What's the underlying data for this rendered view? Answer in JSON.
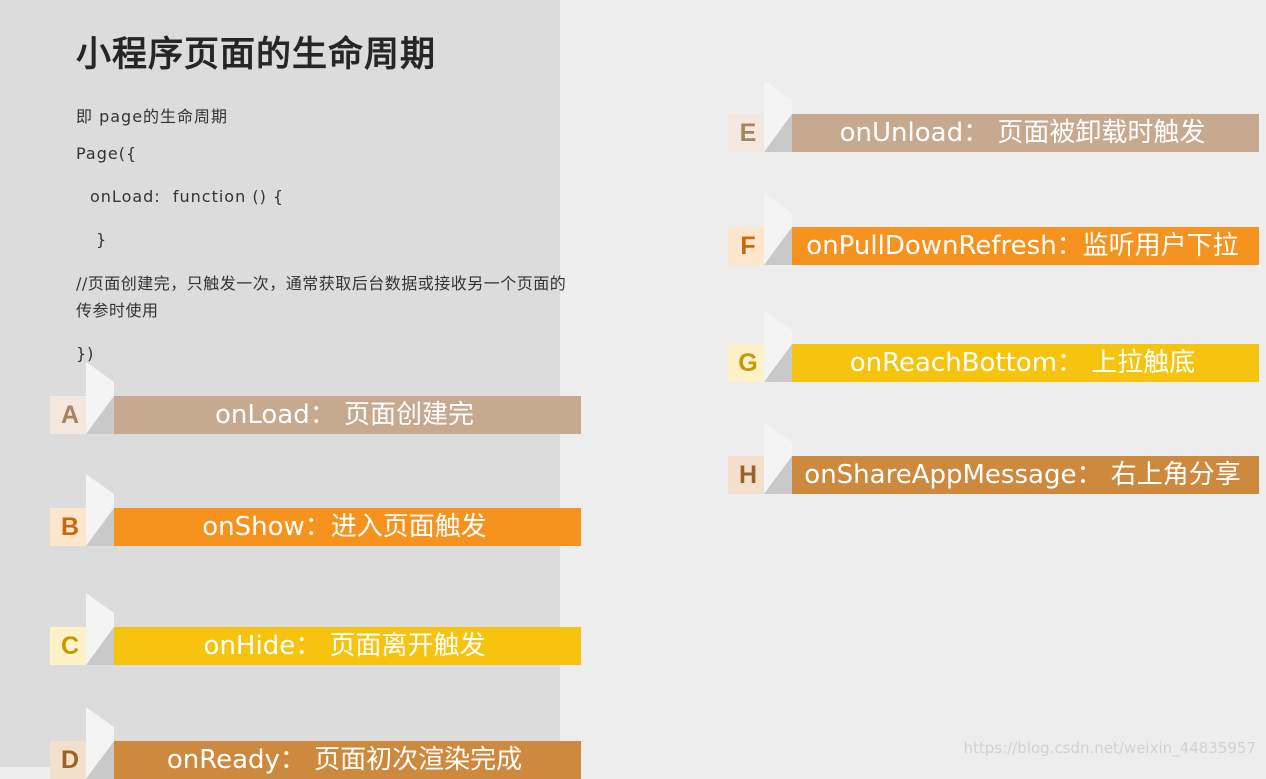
{
  "title": "小程序页面的生命周期",
  "code": {
    "line1": "即 page的生命周期",
    "line2": "Page({",
    "line3": "onLoad:  function () {",
    "line4": "}",
    "comment": "//页面创建完，只触发一次，通常获取后台数据或接收另一个页面的传参时使用",
    "line5": "})"
  },
  "lifecycle": {
    "a": {
      "letter": "A",
      "label": "onLoad：  页面创建完",
      "color": "#c6a98e",
      "letter_bg": "#f2e8df",
      "letter_color": "#a7845f"
    },
    "b": {
      "letter": "B",
      "label": "onShow：进入页面触发",
      "color": "#f6921e",
      "letter_bg": "#fde6cc",
      "letter_color": "#c66a0c"
    },
    "c": {
      "letter": "C",
      "label": "onHide：  页面离开触发",
      "color": "#f6c40e",
      "letter_bg": "#fdf1c8",
      "letter_color": "#c49a05"
    },
    "d": {
      "letter": "D",
      "label": "onReady：  页面初次渲染完成",
      "color": "#cd8a3e",
      "letter_bg": "#f2e0cc",
      "letter_color": "#9a6326"
    },
    "e": {
      "letter": "E",
      "label": "onUnload：  页面被卸载时触发",
      "color": "#c6a98e",
      "letter_bg": "#f2e8df",
      "letter_color": "#a7845f"
    },
    "f": {
      "letter": "F",
      "label": "onPullDownRefresh：监听用户下拉",
      "color": "#f6921e",
      "letter_bg": "#fde6cc",
      "letter_color": "#c66a0c"
    },
    "g": {
      "letter": "G",
      "label": "onReachBottom：  上拉触底",
      "color": "#f6c40e",
      "letter_bg": "#fdf1c8",
      "letter_color": "#c49a05"
    },
    "h": {
      "letter": "H",
      "label": "onShareAppMessage：  右上角分享",
      "color": "#cd8a3e",
      "letter_bg": "#f2e0cc",
      "letter_color": "#9a6326"
    }
  },
  "watermark": "https://blog.csdn.net/weixin_44835957"
}
